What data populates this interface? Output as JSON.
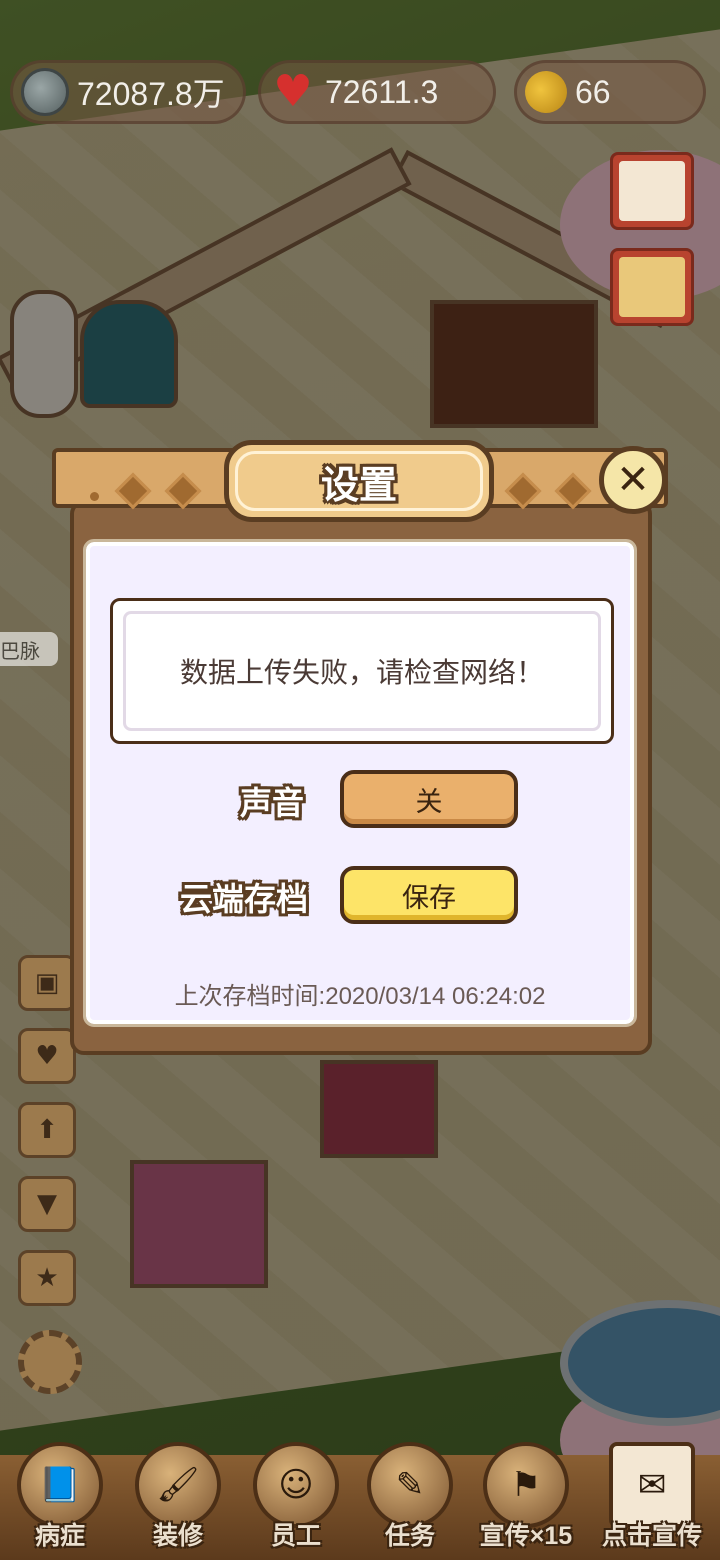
{
  "resources": {
    "silver": "72087.8万",
    "hearts": "72611.3",
    "leaves": "66"
  },
  "sidebar_left": {
    "tag_partial": "巴脉"
  },
  "dialog": {
    "title": "设置",
    "message": "数据上传失败，请检查网络！",
    "sound_label": "声音",
    "sound_value": "关",
    "cloud_label": "云端存档",
    "cloud_button": "保存",
    "last_save": "上次存档时间:2020/03/14 06:24:02",
    "close_symbol": "✕"
  },
  "bottom_nav": [
    {
      "label": "病症",
      "icon": "book-icon"
    },
    {
      "label": "装修",
      "icon": "brush-icon"
    },
    {
      "label": "员工",
      "icon": "staff-icon"
    },
    {
      "label": "任务",
      "icon": "scroll-icon"
    },
    {
      "label": "宣传×15",
      "icon": "banner-icon"
    },
    {
      "label": "点击宣传",
      "icon": "famous-doctor-icon"
    }
  ],
  "colors": {
    "frame": "#8a6340",
    "body_bg": "#f3efff",
    "off_button": "#eab06c",
    "save_button": "#fde468"
  }
}
